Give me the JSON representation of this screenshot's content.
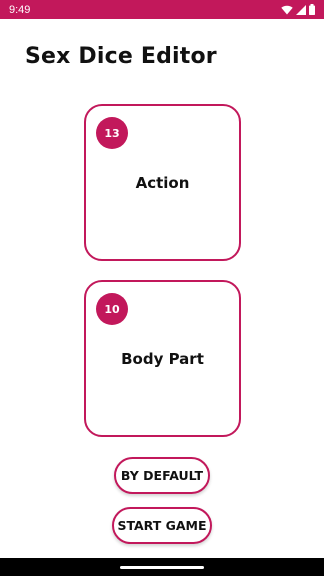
{
  "status_bar": {
    "time": "9:49",
    "color": "#c2185b",
    "icons": [
      "wifi-icon",
      "signal-icon",
      "battery-icon"
    ]
  },
  "page": {
    "title": "Sex Dice Editor"
  },
  "cards": [
    {
      "count": "13",
      "label": "Action"
    },
    {
      "count": "10",
      "label": "Body Part"
    }
  ],
  "buttons": {
    "by_default": "BY DEFAULT",
    "start_game": "START GAME"
  },
  "theme": {
    "accent": "#c2185b",
    "text": "#111111",
    "background": "#ffffff"
  }
}
